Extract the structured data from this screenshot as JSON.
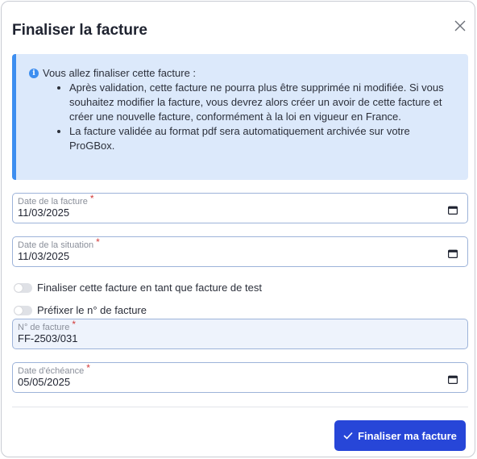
{
  "modal": {
    "title": "Finaliser la facture"
  },
  "info": {
    "intro": "Vous allez finaliser cette facture :",
    "bullets": [
      "Après validation, cette facture ne pourra plus être supprimée ni modifiée. Si vous souhaitez modifier la facture, vous devrez alors créer un avoir de cette facture et créer une nouvelle facture, conformément à la loi en vigueur en France.",
      "La facture validée au format pdf sera automatiquement archivée sur votre ProGBox."
    ]
  },
  "form": {
    "invoice_date": {
      "label": "Date de la facture",
      "value": "11/03/2025",
      "required_mark": "*"
    },
    "situation_date": {
      "label": "Date de la situation",
      "value": "11/03/2025",
      "required_mark": "*"
    },
    "test_toggle": {
      "label": "Finaliser cette facture en tant que facture de test",
      "checked": false
    },
    "prefix_toggle": {
      "label": "Préfixer le n° de facture",
      "checked": false
    },
    "invoice_number": {
      "label": "N° de facture",
      "value": "FF-2503/031",
      "required_mark": "*"
    },
    "due_date": {
      "label": "Date d'échéance",
      "value": "05/05/2025",
      "required_mark": "*"
    }
  },
  "footer": {
    "submit_label": "Finaliser ma facture"
  },
  "colors": {
    "primary": "#2746d8",
    "info_bg": "#dce9fb",
    "info_accent": "#3d8ef0",
    "required": "#d23b3b"
  }
}
